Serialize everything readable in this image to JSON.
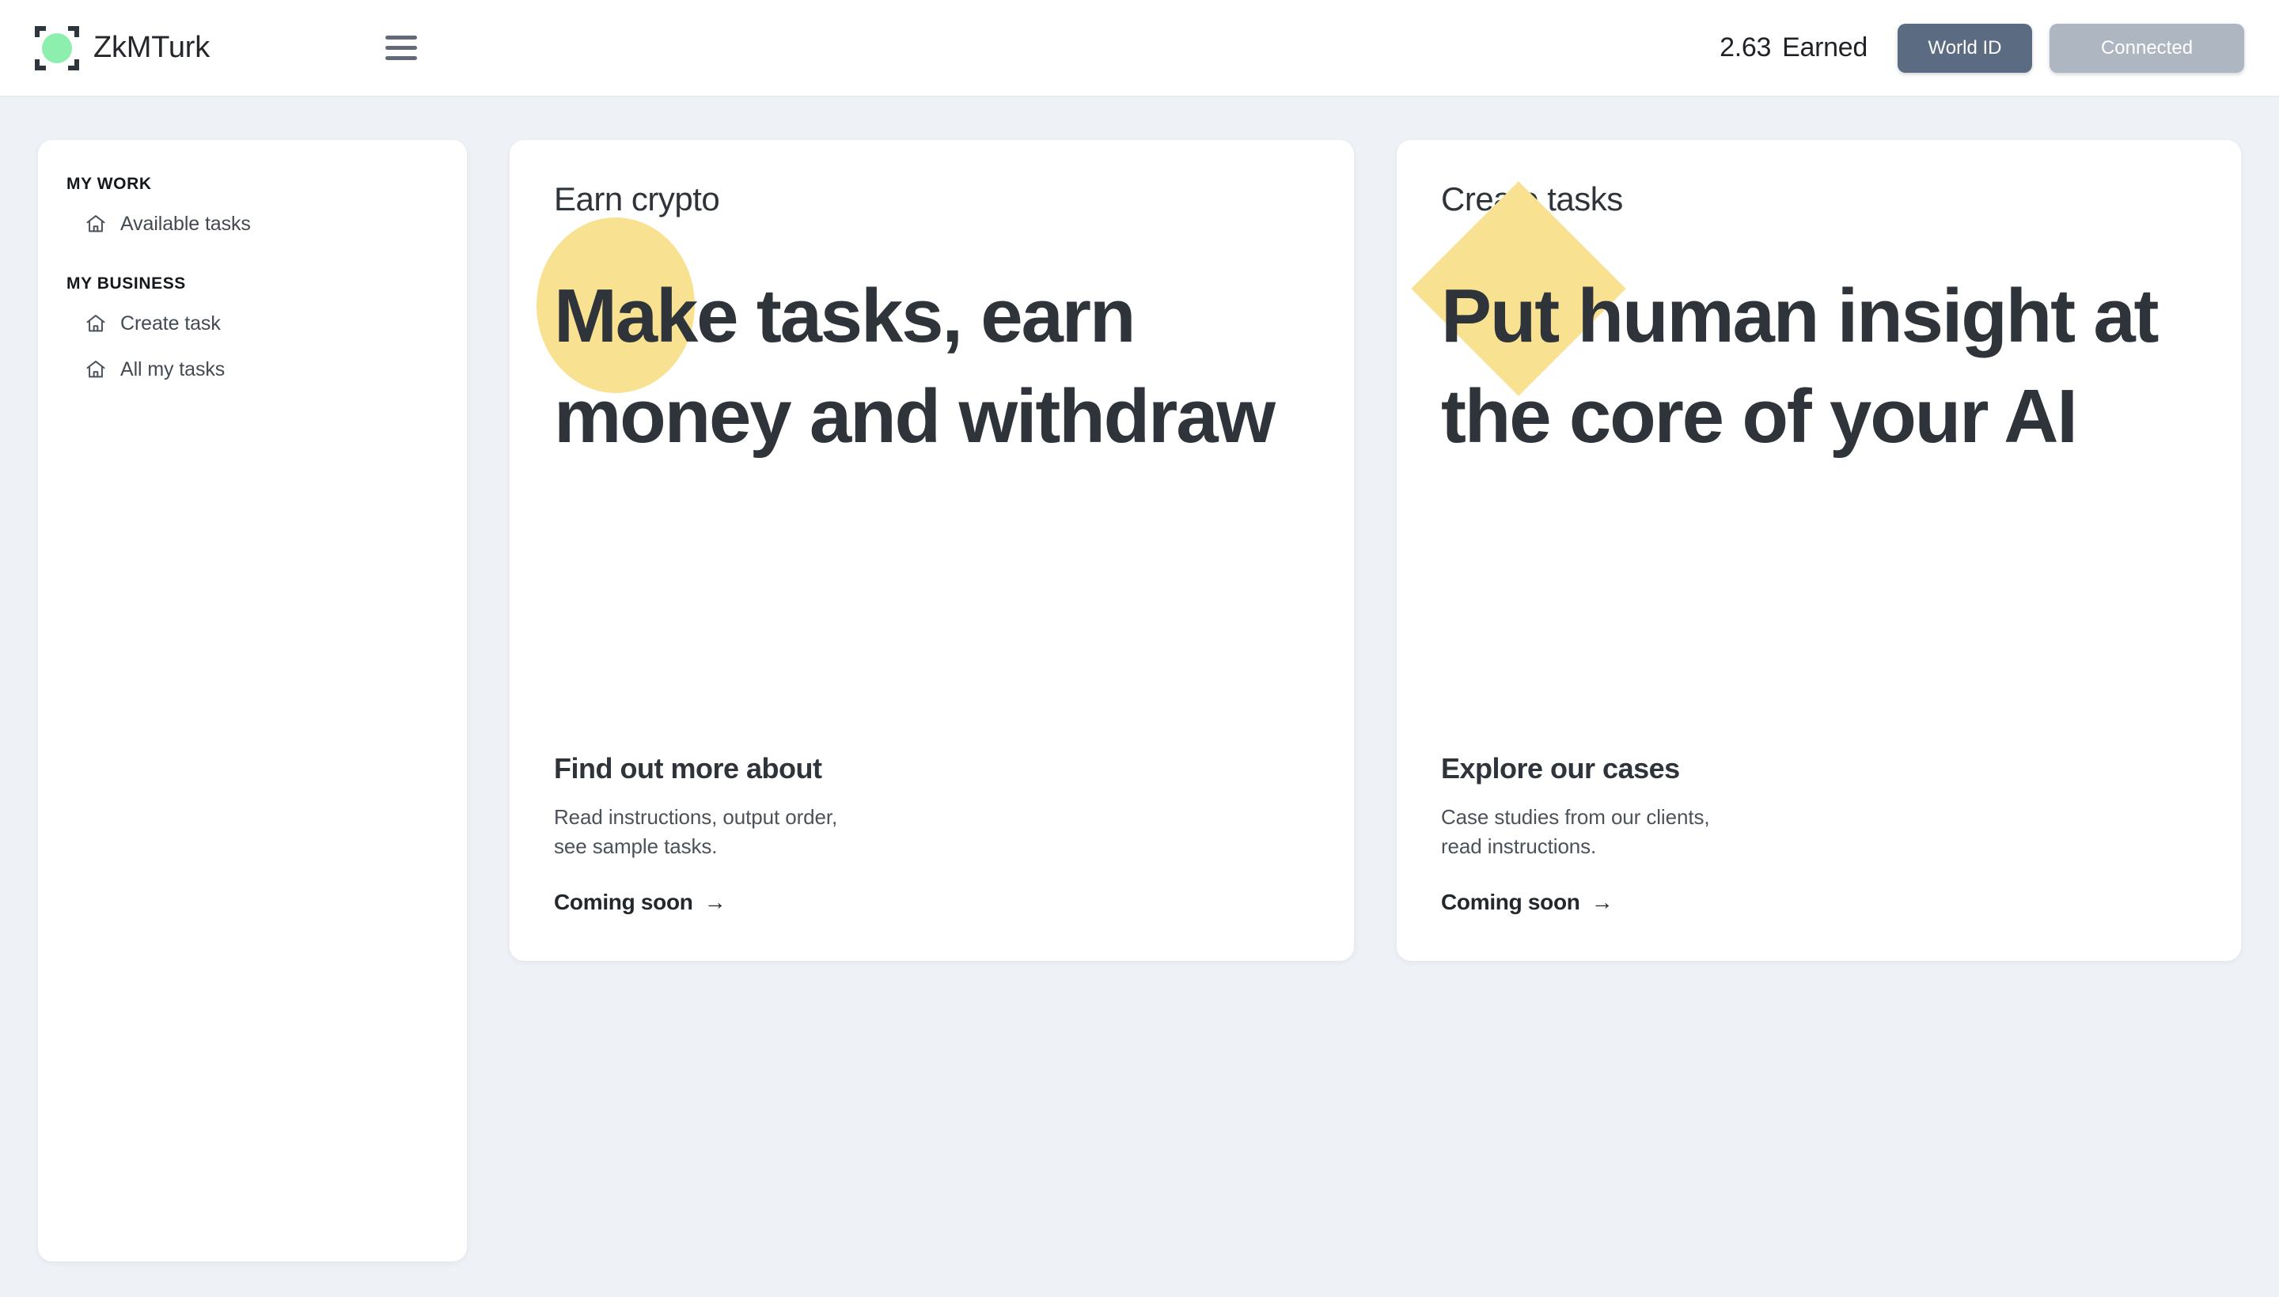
{
  "header": {
    "brand_name": "ZkMTurk",
    "logo_icon": "crop-marks-circle-logo",
    "logo_color": "#8cefae",
    "menu_icon": "hamburger-menu-icon",
    "earned_amount": "2.63",
    "earned_label": "Earned",
    "world_id_label": "World ID",
    "world_id_color": "#5b6b82",
    "connected_label": "Connected",
    "connected_color": "#aeb6c1"
  },
  "sidebar": {
    "sections": [
      {
        "title": "MY WORK",
        "items": [
          {
            "label": "Available tasks",
            "icon": "home-icon"
          }
        ]
      },
      {
        "title": "MY BUSINESS",
        "items": [
          {
            "label": "Create task",
            "icon": "home-icon"
          },
          {
            "label": "All my tasks",
            "icon": "home-icon"
          }
        ]
      }
    ]
  },
  "cards": [
    {
      "eyebrow": "Earn crypto",
      "headline": "Make tasks, earn money and withdraw",
      "shape": "circle",
      "shape_color": "#f8e291",
      "sub_title": "Find out more about",
      "sub_desc": "Read instructions, output order,\nsee sample tasks.",
      "cta_label": "Coming soon",
      "cta_icon": "arrow-right-icon"
    },
    {
      "eyebrow": "Create tasks",
      "headline": "Put human insight at the core of your AI",
      "shape": "diamond",
      "shape_color": "#f8e291",
      "sub_title": "Explore our cases",
      "sub_desc": "Case studies from our clients,\nread instructions.",
      "cta_label": "Coming soon",
      "cta_icon": "arrow-right-icon"
    }
  ],
  "theme": {
    "page_background": "#eef1f5",
    "card_background": "#ffffff",
    "text_primary": "#2e343a",
    "accent_yellow": "#f8e291",
    "accent_green": "#8cefae"
  }
}
